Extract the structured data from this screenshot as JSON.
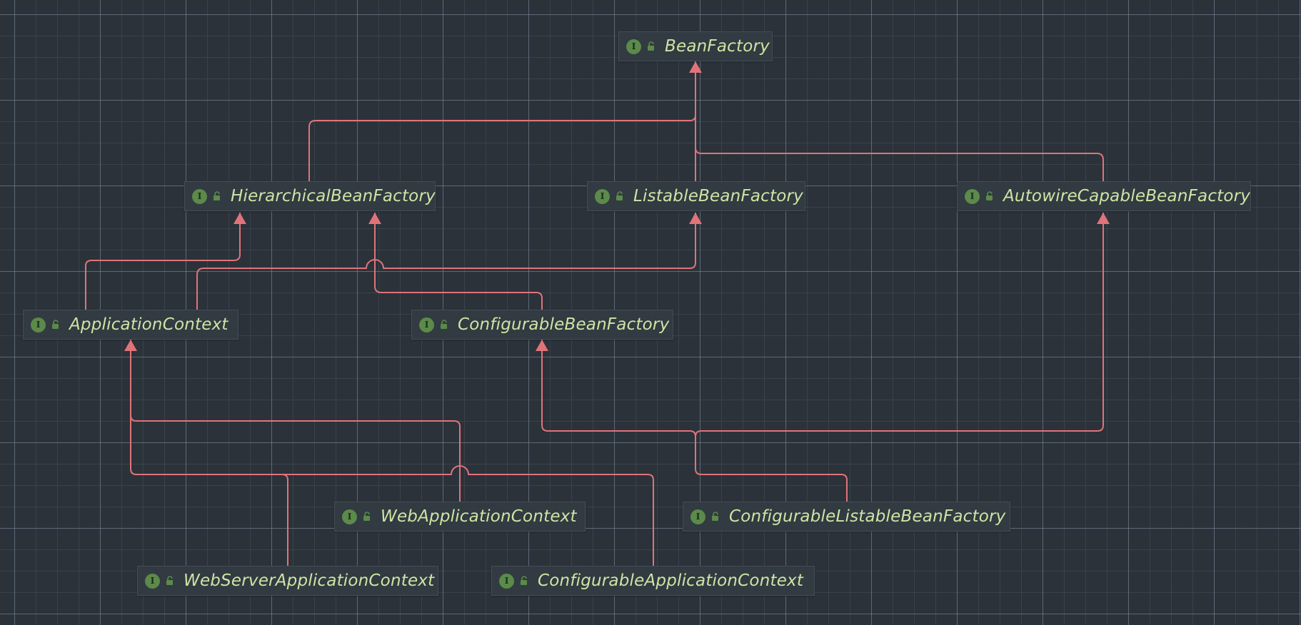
{
  "nodes": [
    {
      "id": "beanfactory",
      "label": "BeanFactory",
      "icon": "interface-icon"
    },
    {
      "id": "hierarchical",
      "label": "HierarchicalBeanFactory",
      "icon": "interface-icon"
    },
    {
      "id": "listable",
      "label": "ListableBeanFactory",
      "icon": "interface-icon"
    },
    {
      "id": "autowire",
      "label": "AutowireCapableBeanFactory",
      "icon": "interface-icon"
    },
    {
      "id": "appcontext",
      "label": "ApplicationContext",
      "icon": "interface-icon"
    },
    {
      "id": "configurablebf",
      "label": "ConfigurableBeanFactory",
      "icon": "interface-icon"
    },
    {
      "id": "webappcontext",
      "label": "WebApplicationContext",
      "icon": "interface-icon"
    },
    {
      "id": "configlistable",
      "label": "ConfigurableListableBeanFactory",
      "icon": "interface-icon"
    },
    {
      "id": "webserver",
      "label": "WebServerApplicationContext",
      "icon": "interface-icon"
    },
    {
      "id": "configappcontext",
      "label": "ConfigurableApplicationContext",
      "icon": "interface-icon"
    }
  ],
  "edges": [
    {
      "from": "hierarchical",
      "to": "beanfactory",
      "relation": "extends"
    },
    {
      "from": "listable",
      "to": "beanfactory",
      "relation": "extends"
    },
    {
      "from": "autowire",
      "to": "beanfactory",
      "relation": "extends"
    },
    {
      "from": "appcontext",
      "to": "hierarchical",
      "relation": "extends"
    },
    {
      "from": "appcontext",
      "to": "listable",
      "relation": "extends"
    },
    {
      "from": "configurablebf",
      "to": "hierarchical",
      "relation": "extends"
    },
    {
      "from": "webappcontext",
      "to": "appcontext",
      "relation": "extends"
    },
    {
      "from": "webserver",
      "to": "appcontext",
      "relation": "extends"
    },
    {
      "from": "configappcontext",
      "to": "appcontext",
      "relation": "extends"
    },
    {
      "from": "configlistable",
      "to": "configurablebf",
      "relation": "extends"
    },
    {
      "from": "configlistable",
      "to": "listable",
      "relation": "extends"
    },
    {
      "from": "configlistable",
      "to": "autowire",
      "relation": "extends"
    }
  ],
  "colors": {
    "background": "#2b323a",
    "node_fill": "#323a42",
    "node_border": "#454e57",
    "node_text": "#cde5a4",
    "interface_badge": "#5b8a4a",
    "edge": "#e0737a"
  }
}
